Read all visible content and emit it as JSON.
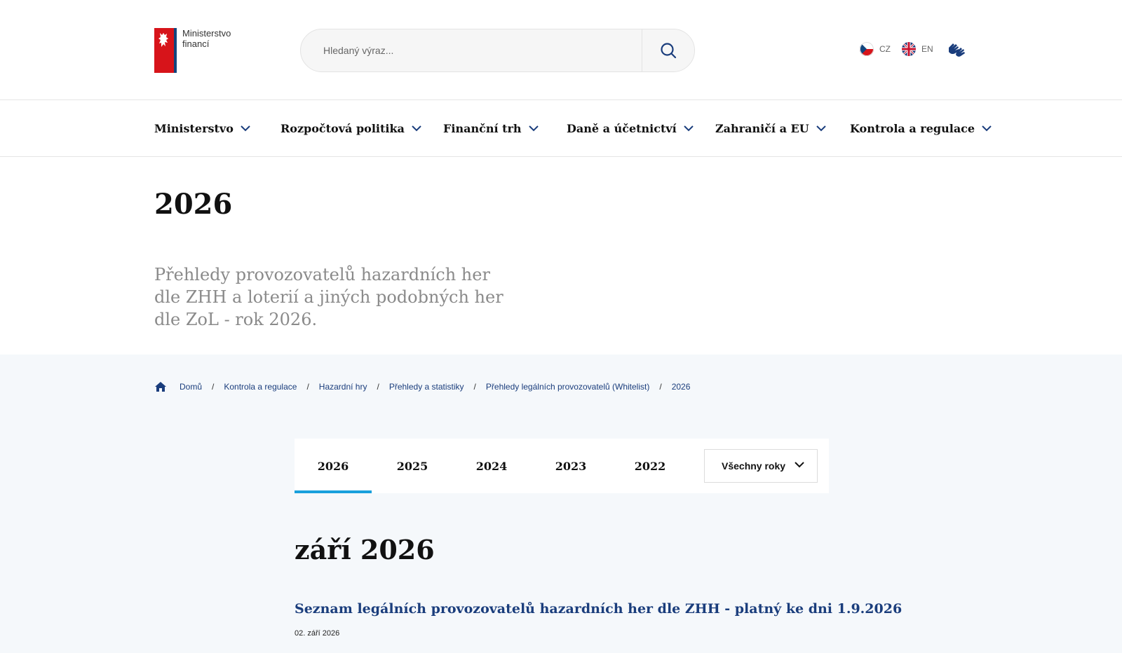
{
  "header": {
    "logo_line1": "Ministerstvo",
    "logo_line2": "financí",
    "search_placeholder": "Hledaný výraz...",
    "languages": [
      {
        "code": "CZ"
      },
      {
        "code": "EN"
      }
    ]
  },
  "nav": {
    "items": [
      {
        "label": "Ministerstvo"
      },
      {
        "label": "Rozpočtová politika"
      },
      {
        "label": "Finanční trh"
      },
      {
        "label": "Daně a účetnictví"
      },
      {
        "label": "Zahraničí a EU"
      },
      {
        "label": "Kontrola a regulace"
      }
    ]
  },
  "page": {
    "title": "2026",
    "lead": "Přehledy provozovatelů hazardních her dle ZHH a loterií a jiných podobných her dle ZoL - rok 2026."
  },
  "breadcrumb": [
    {
      "label": "Domů"
    },
    {
      "label": "Kontrola a regulace"
    },
    {
      "label": "Hazardní hry"
    },
    {
      "label": "Přehledy a statistiky"
    },
    {
      "label": "Přehledy legálních provozovatelů (Whitelist)"
    },
    {
      "label": "2026"
    }
  ],
  "tabs": [
    {
      "label": "2026",
      "active": true
    },
    {
      "label": "2025"
    },
    {
      "label": "2024"
    },
    {
      "label": "2023"
    },
    {
      "label": "2022"
    }
  ],
  "years_select": {
    "label": "Všechny roky"
  },
  "content": {
    "month_title": "září 2026",
    "item_title": "Seznam legálních provozovatelů hazardních her dle ZHH - platný ke dni 1.9.2026",
    "item_date": "02. září 2026"
  },
  "colors": {
    "brand_blue": "#1a3d7c",
    "tab_active": "#19a0dc",
    "logo_red": "#d7141a",
    "band": "#f5f8fb"
  }
}
